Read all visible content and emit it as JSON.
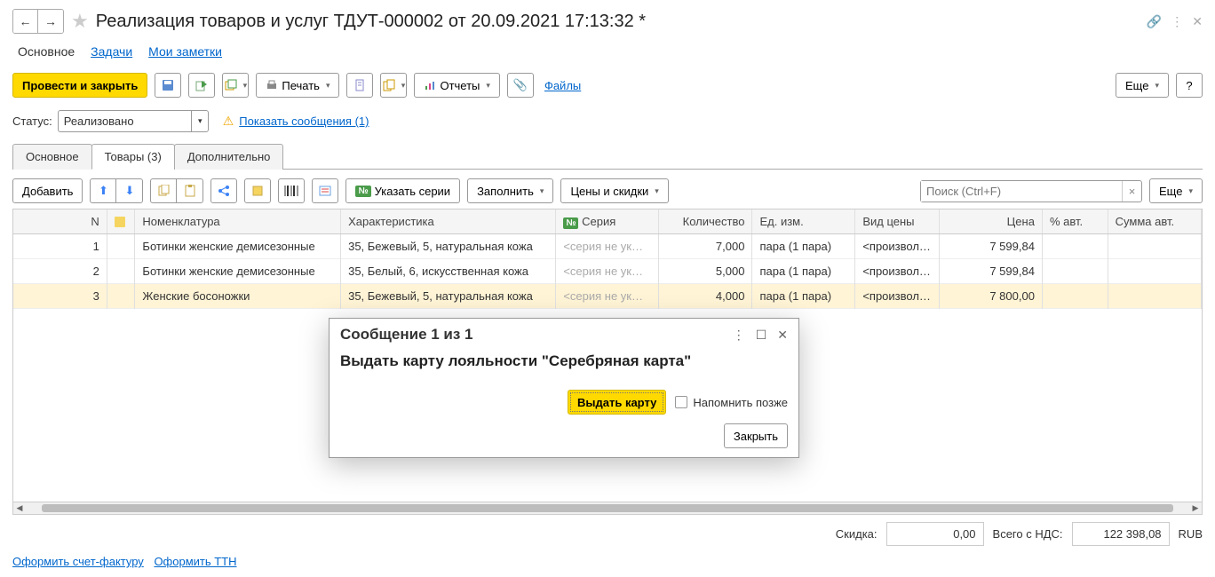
{
  "page_title": "Реализация товаров и услуг ТДУТ-000002 от 20.09.2021 17:13:32 *",
  "sub_tabs": {
    "main": "Основное",
    "tasks": "Задачи",
    "notes": "Мои заметки"
  },
  "toolbar": {
    "post_close": "Провести и закрыть",
    "print": "Печать",
    "reports": "Отчеты",
    "files": "Файлы",
    "more": "Еще"
  },
  "status": {
    "label": "Статус:",
    "value": "Реализовано",
    "show_msgs": "Показать сообщения (1)"
  },
  "content_tabs": {
    "main": "Основное",
    "goods": "Товары (3)",
    "extra": "Дополнительно"
  },
  "tab_toolbar": {
    "add": "Добавить",
    "series": "Указать серии",
    "fill": "Заполнить",
    "prices": "Цены и скидки",
    "search_ph": "Поиск (Ctrl+F)",
    "more": "Еще"
  },
  "columns": {
    "n": "N",
    "nom": "Номенклатура",
    "char": "Характеристика",
    "serial": "Серия",
    "qty": "Количество",
    "unit": "Ед. изм.",
    "ptype": "Вид цены",
    "price": "Цена",
    "auto": "% авт.",
    "sum": "Сумма авт."
  },
  "rows": [
    {
      "n": "1",
      "nom": "Ботинки женские демисезонные",
      "char": "35, Бежевый, 5, натуральная кожа",
      "serial": "<серия не ук…",
      "qty": "7,000",
      "unit": "пара (1 пара)",
      "ptype": "<произвол…",
      "price": "7 599,84"
    },
    {
      "n": "2",
      "nom": "Ботинки женские демисезонные",
      "char": "35, Белый, 6, искусственная кожа",
      "serial": "<серия не ук…",
      "qty": "5,000",
      "unit": "пара (1 пара)",
      "ptype": "<произвол…",
      "price": "7 599,84"
    },
    {
      "n": "3",
      "nom": "Женские босоножки",
      "char": "35, Бежевый, 5, натуральная кожа",
      "serial": "<серия не ук…",
      "qty": "4,000",
      "unit": "пара (1 пара)",
      "ptype": "<произвол…",
      "price": "7 800,00"
    }
  ],
  "footer": {
    "discount_label": "Скидка:",
    "discount_value": "0,00",
    "total_label": "Всего с НДС:",
    "total_value": "122 398,08",
    "currency": "RUB",
    "invoice_link": "Оформить счет-фактуру",
    "ttn_link": "Оформить ТТН"
  },
  "modal": {
    "title": "Сообщение 1 из 1",
    "body": "Выдать карту лояльности \"Серебряная карта\"",
    "issue": "Выдать карту",
    "remind": "Напомнить позже",
    "close": "Закрыть"
  }
}
